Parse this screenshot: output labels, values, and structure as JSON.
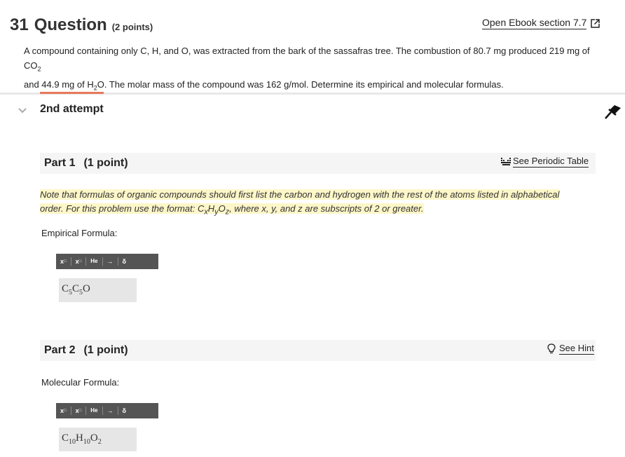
{
  "question": {
    "number": "31",
    "title": "Question",
    "points": "(2 points)",
    "ebook_link": "Open Ebook section 7.7",
    "text_parts": {
      "p1": "A compound containing only C, H, and O, was extracted from the bark of the sassafras tree. The combustion of 80.7  mg produced 219  mg of CO",
      "p1_sub": "2",
      "p2": "and 44.9  mg of H",
      "p2_sub": "2",
      "p3": "O. The molar mass of the compound was 162 g/mol. Determine its empirical and molecular formulas."
    }
  },
  "attempt": {
    "label": "2nd attempt"
  },
  "part1": {
    "title": "Part 1",
    "points": "(1 point)",
    "periodic_link": "See Periodic Table",
    "note_a": "Note that formulas of organic compounds should first list the carbon and hydrogen with the rest of the atoms listed in alphabetical",
    "note_b1": "order. For this problem use the format: C",
    "note_b_x": "x",
    "note_b_h": "H",
    "note_b_y": "y",
    "note_b_o": "O",
    "note_b_z": "z",
    "note_b2": ", where x, y, and z are subscripts of 2 or greater.",
    "field_label": "Empirical Formula:",
    "answer": {
      "c1": "C",
      "s1": "5",
      "c2": "C",
      "s2": "5",
      "c3": "O"
    }
  },
  "part2": {
    "title": "Part 2",
    "points": "(1 point)",
    "hint_link": "See Hint",
    "field_label": "Molecular Formula:",
    "answer": {
      "c1": "C",
      "s1": "10",
      "c2": "H",
      "s2": "10",
      "c3": "O",
      "s3": "2"
    }
  },
  "toolbar": {
    "superscript": "x",
    "subscript": "x",
    "isotope": "He",
    "arrow": "→",
    "delta": "δ"
  },
  "colors": {
    "accent": "#e8795a",
    "highlight": "#fdf6c8",
    "toolbar_bg": "#555555",
    "answer_bg": "#e6e6e6"
  }
}
